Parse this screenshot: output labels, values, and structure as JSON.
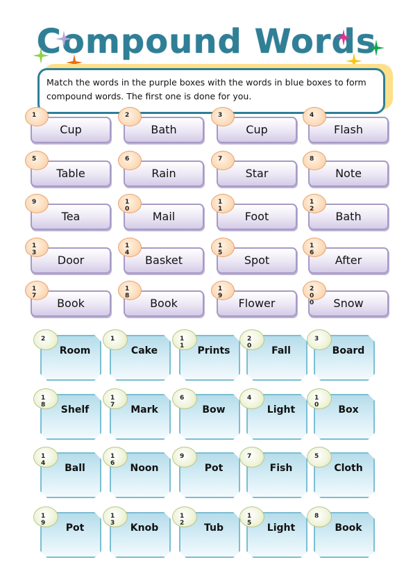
{
  "title": "Compound Words",
  "instructions": "Match the words in the  purple boxes  with the words in blue boxes   to form compound words. The first one is done for you.",
  "colors": {
    "title": "#2f7f96",
    "purple_box": "#ebe6f4",
    "blue_box": "#d8eef6",
    "orange_badge": "#fbd7b4",
    "green_badge": "#eef3d8",
    "instruction_border": "#2f7f96",
    "instruction_shadow": "#ffe08a"
  },
  "stars": [
    "lilac-star",
    "green-star",
    "orange-star",
    "pink-star",
    "green-star",
    "yellow-star"
  ],
  "purple_words": [
    {
      "num": "1",
      "word": "Cup"
    },
    {
      "num": "2",
      "word": "Bath"
    },
    {
      "num": "3",
      "word": "Cup"
    },
    {
      "num": "4",
      "word": "Flash"
    },
    {
      "num": "5",
      "word": "Table"
    },
    {
      "num": "6",
      "word": "Rain"
    },
    {
      "num": "7",
      "word": "Star"
    },
    {
      "num": "8",
      "word": "Note"
    },
    {
      "num": "9",
      "word": "Tea"
    },
    {
      "num": "10",
      "word": "Mail"
    },
    {
      "num": "11",
      "word": "Foot"
    },
    {
      "num": "12",
      "word": "Bath"
    },
    {
      "num": "13",
      "word": "Door"
    },
    {
      "num": "14",
      "word": "Basket"
    },
    {
      "num": "15",
      "word": "Spot"
    },
    {
      "num": "16",
      "word": "After"
    },
    {
      "num": "17",
      "word": "Book"
    },
    {
      "num": "18",
      "word": "Book"
    },
    {
      "num": "19",
      "word": "Flower"
    },
    {
      "num": "200",
      "word": "Snow"
    }
  ],
  "blue_words": [
    {
      "num": "2",
      "word": "Room"
    },
    {
      "num": "1",
      "word": "Cake"
    },
    {
      "num": "11",
      "word": "Prints"
    },
    {
      "num": "20",
      "word": "Fall"
    },
    {
      "num": "3",
      "word": "Board"
    },
    {
      "num": "18",
      "word": "Shelf"
    },
    {
      "num": "17",
      "word": "Mark"
    },
    {
      "num": "6",
      "word": "Bow"
    },
    {
      "num": "4",
      "word": "Light"
    },
    {
      "num": "10",
      "word": "Box"
    },
    {
      "num": "14",
      "word": "Ball"
    },
    {
      "num": "16",
      "word": "Noon"
    },
    {
      "num": "9",
      "word": "Pot"
    },
    {
      "num": "7",
      "word": "Fish"
    },
    {
      "num": "5",
      "word": "Cloth"
    },
    {
      "num": "19",
      "word": "Pot"
    },
    {
      "num": "13",
      "word": "Knob"
    },
    {
      "num": "12",
      "word": "Tub"
    },
    {
      "num": "15",
      "word": "Light"
    },
    {
      "num": "8",
      "word": "Book"
    }
  ]
}
